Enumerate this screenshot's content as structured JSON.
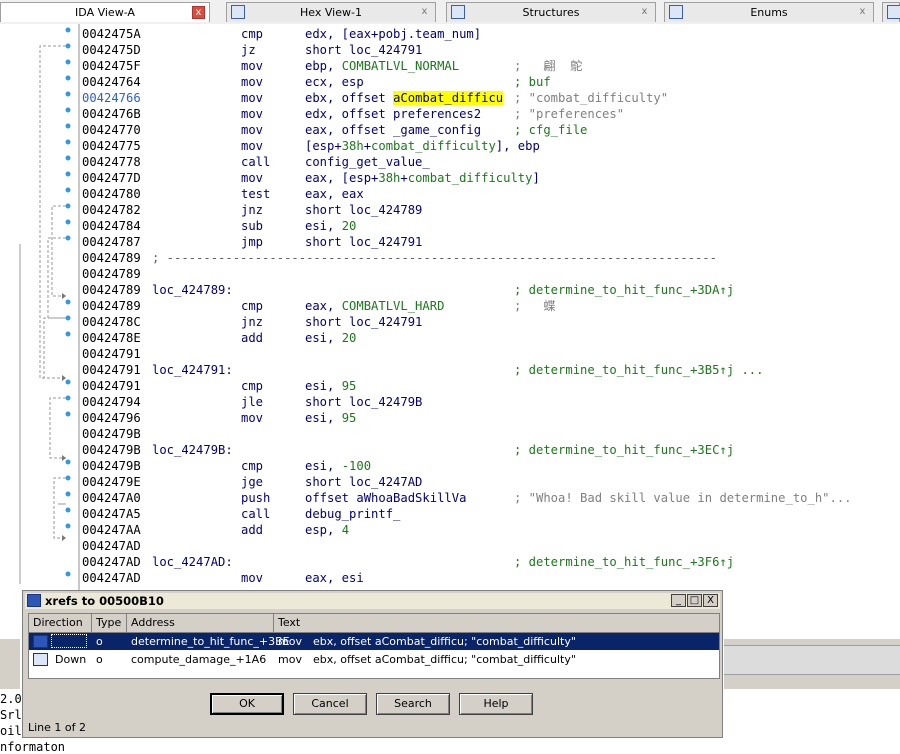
{
  "tabs": [
    {
      "label": "IDA View-A",
      "icon": "ida-view-icon",
      "active": true
    },
    {
      "label": "Hex View-1",
      "icon": "hex-view-icon",
      "active": false
    },
    {
      "label": "Structures",
      "icon": "structures-icon",
      "active": false
    },
    {
      "label": "Enums",
      "icon": "enums-icon",
      "active": false
    }
  ],
  "tab_close_glyph": "x",
  "code": {
    "lines": [
      {
        "addr": "0042475A",
        "mnem": "cmp",
        "ops": "edx, [eax+pobj.team_num]"
      },
      {
        "addr": "0042475D",
        "mnem": "jz",
        "ops": "short loc_424791"
      },
      {
        "addr": "0042475F",
        "mnem": "mov",
        "ops_pre": "ebp, ",
        "ops_sym": "COMBATLVL_NORMAL",
        "comment_gray": ";   翩  鴕"
      },
      {
        "addr": "00424764",
        "mnem": "mov",
        "ops": "ecx, esp",
        "comment": "; buf"
      },
      {
        "addr": "00424766",
        "highlight_addr": true,
        "mnem": "mov",
        "ops_pre": "ebx, offset ",
        "ops_hl": "aCombat_difficu",
        "comment_gray": "; \"combat_difficulty\""
      },
      {
        "addr": "0042476B",
        "mnem": "mov",
        "ops": "edx, offset preferences2",
        "comment_gray": "; \"preferences\""
      },
      {
        "addr": "00424770",
        "mnem": "mov",
        "ops": "eax, offset _game_config",
        "comment": "; cfg_file"
      },
      {
        "addr": "00424775",
        "mnem": "mov",
        "ops_pre": "[esp+",
        "ops_num": "38h",
        "ops_mid": "+",
        "ops_sym2": "combat_difficulty",
        "ops_post": "], ebp"
      },
      {
        "addr": "00424778",
        "mnem": "call",
        "ops": "config_get_value_"
      },
      {
        "addr": "0042477D",
        "mnem": "mov",
        "ops_pre": "eax, [esp+",
        "ops_num": "38h",
        "ops_mid": "+",
        "ops_sym2": "combat_difficulty",
        "ops_post": "]"
      },
      {
        "addr": "00424780",
        "mnem": "test",
        "ops": "eax, eax"
      },
      {
        "addr": "00424782",
        "mnem": "jnz",
        "ops": "short loc_424789"
      },
      {
        "addr": "00424784",
        "mnem": "sub",
        "ops_pre": "esi, ",
        "ops_num": "20"
      },
      {
        "addr": "00424787",
        "mnem": "jmp",
        "ops": "short loc_424791"
      },
      {
        "addr": "00424789",
        "separator": "; ---------------------------------------------------------------------------"
      },
      {
        "addr": "00424789"
      },
      {
        "addr": "00424789",
        "label": "loc_424789:",
        "comment": "; determine_to_hit_func_+3DA↑j"
      },
      {
        "addr": "00424789",
        "mnem": "cmp",
        "ops_pre": "eax, ",
        "ops_sym": "COMBATLVL_HARD",
        "comment_gray": ";   蝶"
      },
      {
        "addr": "0042478C",
        "mnem": "jnz",
        "ops": "short loc_424791"
      },
      {
        "addr": "0042478E",
        "mnem": "add",
        "ops_pre": "esi, ",
        "ops_num": "20"
      },
      {
        "addr": "00424791"
      },
      {
        "addr": "00424791",
        "label": "loc_424791:",
        "comment": "; determine_to_hit_func_+3B5↑j ..."
      },
      {
        "addr": "00424791",
        "mnem": "cmp",
        "ops_pre": "esi, ",
        "ops_num": "95"
      },
      {
        "addr": "00424794",
        "mnem": "jle",
        "ops": "short loc_42479B"
      },
      {
        "addr": "00424796",
        "mnem": "mov",
        "ops_pre": "esi, ",
        "ops_num": "95"
      },
      {
        "addr": "0042479B"
      },
      {
        "addr": "0042479B",
        "label": "loc_42479B:",
        "comment": "; determine_to_hit_func_+3EC↑j"
      },
      {
        "addr": "0042479B",
        "mnem": "cmp",
        "ops_pre": "esi, ",
        "ops_num": "-100"
      },
      {
        "addr": "0042479E",
        "mnem": "jge",
        "ops": "short loc_4247AD"
      },
      {
        "addr": "004247A0",
        "mnem": "push",
        "ops": "offset aWhoaBadSkillVa",
        "comment_gray": "; \"Whoa! Bad skill value in determine_to_h\"..."
      },
      {
        "addr": "004247A5",
        "mnem": "call",
        "ops": "debug_printf_"
      },
      {
        "addr": "004247AA",
        "mnem": "add",
        "ops_pre": "esp, ",
        "ops_num": "4"
      },
      {
        "addr": "004247AD"
      },
      {
        "addr": "004247AD",
        "label": "loc_4247AD:",
        "comment": "; determine_to_hit_func_+3F6↑j"
      },
      {
        "addr": "004247AD",
        "mnem": "mov",
        "ops": "eax, esi"
      }
    ]
  },
  "bottom_fragments": [
    "2.0",
    "Srl",
    "oil",
    "nformaton"
  ],
  "xrefs_dialog": {
    "title": "xrefs to 00500B10",
    "window_buttons": {
      "minimize": "_",
      "maximize": "□",
      "close": "X"
    },
    "columns": [
      "Direction",
      "Type",
      "Address",
      "Text"
    ],
    "rows": [
      {
        "direction": "",
        "type": "o",
        "address": "determine_to_hit_func_+3BE",
        "mnem": "mov",
        "text": "ebx, offset aCombat_difficu; \"combat_difficulty\"",
        "selected": true
      },
      {
        "direction": "Down",
        "type": "o",
        "address": "compute_damage_+1A6",
        "mnem": "mov",
        "text": "ebx, offset aCombat_difficu; \"combat_difficulty\"",
        "selected": false
      }
    ],
    "buttons": {
      "ok": "OK",
      "cancel": "Cancel",
      "search": "Search",
      "help": "Help"
    },
    "status": "Line 1 of 2"
  }
}
